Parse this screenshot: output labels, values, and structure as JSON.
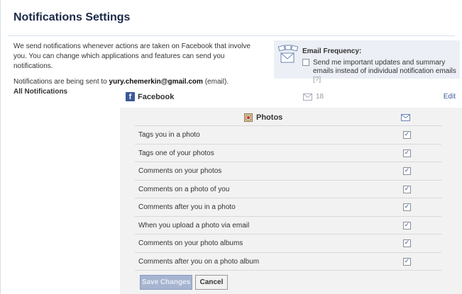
{
  "page": {
    "title": "Notifications Settings"
  },
  "intro": {
    "line1": "We send notifications whenever actions are taken on Facebook that involve you. You can change which applications and features can send you notifications.",
    "sent_prefix": "Notifications are being sent to ",
    "email": "yury.chemerkin@gmail.com",
    "sent_suffix": " (email)."
  },
  "email_frequency": {
    "title": "Email Frequency:",
    "option_label": "Send me important updates and summary emails instead of individual notification emails",
    "help": "[?]",
    "checked": false
  },
  "all_notifications": {
    "label": "All Notifications"
  },
  "facebook": {
    "logo": "f",
    "name": "Facebook",
    "count": "18",
    "edit_label": "Edit"
  },
  "photos": {
    "header": "Photos",
    "items": [
      {
        "label": "Tags you in a photo",
        "email": true
      },
      {
        "label": "Tags one of your photos",
        "email": true
      },
      {
        "label": "Comments on your photos",
        "email": true
      },
      {
        "label": "Comments on a photo of you",
        "email": true
      },
      {
        "label": "Comments after you in a photo",
        "email": true
      },
      {
        "label": "When you upload a photo via email",
        "email": true
      },
      {
        "label": "Comments on your photo albums",
        "email": true
      },
      {
        "label": "Comments after you on a photo album",
        "email": true
      }
    ]
  },
  "buttons": {
    "save": "Save Changes",
    "cancel": "Cancel"
  },
  "icons": {
    "facebook": "facebook-logo-icon",
    "mail": "envelope-icon",
    "photos": "photos-app-icon",
    "email_frequency": "email-frequency-icon",
    "checkbox": "checkmark-icon"
  },
  "colors": {
    "brand": "#3b5998",
    "title": "#1c2a47",
    "panel_bg": "#f2f2f2",
    "freq_bg": "#eceff5"
  }
}
